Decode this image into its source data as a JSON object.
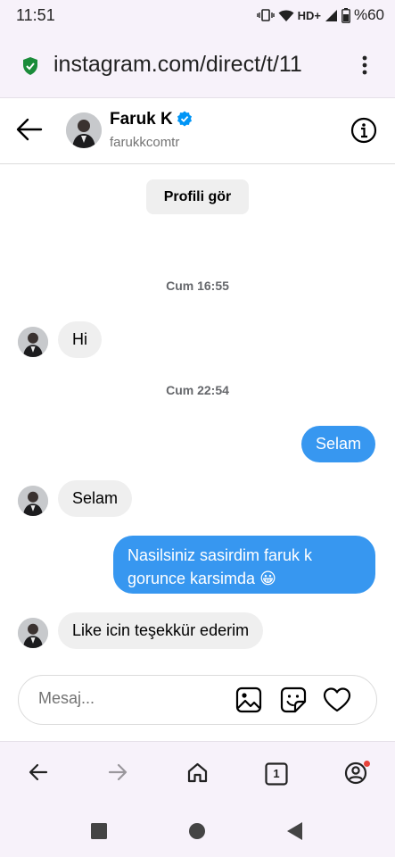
{
  "status_bar": {
    "time": "11:51",
    "network": "HD+",
    "battery": "%60"
  },
  "browser": {
    "url": "instagram.com/direct/t/11",
    "tab_count": "1"
  },
  "chat": {
    "contact_name": "Faruk K",
    "contact_username": "farukkcomtr",
    "verified": true,
    "profile_button_label": "Profili gör",
    "messages": [
      {
        "type": "timestamp",
        "text": "Cum 16:55"
      },
      {
        "type": "incoming",
        "text": "Hi"
      },
      {
        "type": "timestamp",
        "text": "Cum 22:54"
      },
      {
        "type": "outgoing",
        "text": "Selam"
      },
      {
        "type": "incoming",
        "text": "Selam"
      },
      {
        "type": "outgoing",
        "line1": "Nasilsiniz sasirdim faruk k",
        "line2": "gorunce karsimda 😀"
      },
      {
        "type": "incoming",
        "text": "Like icin teşekkür ederim"
      }
    ]
  },
  "composer": {
    "placeholder": "Mesaj..."
  },
  "icons": {
    "lock": "lock-shield-icon",
    "verified": "verified-badge-icon",
    "info": "info-icon",
    "gallery": "image-icon",
    "sticker": "sticker-icon",
    "heart": "heart-icon"
  },
  "colors": {
    "outgoing_bubble": "#3797f0",
    "incoming_bubble": "#efefef",
    "verified_blue": "#0095f6",
    "notification_dot": "#e8433b"
  }
}
